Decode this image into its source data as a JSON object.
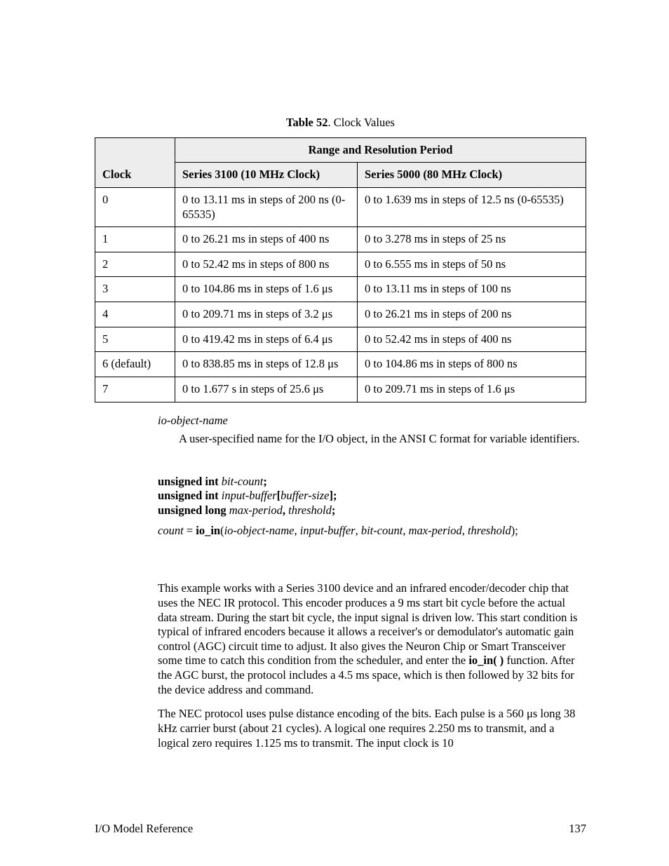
{
  "caption": {
    "label": "Table 52",
    "title": ". Clock Values"
  },
  "table": {
    "clock_header": "Clock",
    "super_header": "Range and Resolution Period",
    "col_3100": "Series 3100 (10 MHz Clock)",
    "col_5000": "Series 5000 (80 MHz Clock)",
    "rows": [
      {
        "clock": "0",
        "s3100": "0 to 13.11 ms in steps of 200 ns (0-65535)",
        "s5000": "0 to 1.639 ms in steps of 12.5 ns (0-65535)"
      },
      {
        "clock": "1",
        "s3100": "0 to 26.21 ms in steps of 400 ns",
        "s5000": "0 to 3.278 ms in steps of 25 ns"
      },
      {
        "clock": "2",
        "s3100": "0 to 52.42 ms in steps of 800 ns",
        "s5000": "0 to 6.555 ms in steps of 50 ns"
      },
      {
        "clock": "3",
        "s3100": "0 to 104.86 ms in steps of 1.6 μs",
        "s5000": "0 to 13.11 ms in steps of 100 ns"
      },
      {
        "clock": "4",
        "s3100": "0 to 209.71 ms in steps of 3.2 μs",
        "s5000": "0 to 26.21 ms in steps of 200 ns"
      },
      {
        "clock": "5",
        "s3100": "0 to 419.42 ms in steps of 6.4 μs",
        "s5000": "0 to 52.42 ms in steps of 400 ns"
      },
      {
        "clock": "6 (default)",
        "s3100": "0 to 838.85 ms in steps of 12.8 μs",
        "s5000": "0 to 104.86 ms in steps of 800 ns"
      },
      {
        "clock": "7",
        "s3100": "0 to 1.677 s in steps of 25.6 μs",
        "s5000": "0 to 209.71 ms in steps of 1.6 μs"
      }
    ]
  },
  "param": {
    "name": "io-object-name",
    "desc": "A user-specified name for the I/O object, in the ANSI C format for variable identifiers."
  },
  "syntax": {
    "l1a": "unsigned int",
    "l1b": " bit-count",
    "l1c": ";",
    "l2a": "unsigned int",
    "l2b": " input-buffer",
    "l2c": "[",
    "l2d": "buffer-size",
    "l2e": "];",
    "l3a": "unsigned long",
    "l3b": " max-period",
    "l3c": ",",
    "l3d": " threshold",
    "l3e": ";",
    "call_a": "count",
    "call_b": " = ",
    "call_c": "io_in",
    "call_d": "(",
    "call_e": "io-object-name",
    "call_f": ", ",
    "call_g": "input-buffer",
    "call_h": ", ",
    "call_i": "bit-count",
    "call_j": ", ",
    "call_k": "max-period",
    "call_l": ", ",
    "call_m": "threshold",
    "call_n": ");"
  },
  "example": {
    "p1a": "This example works with a Series 3100 device and an infrared encoder/decoder chip that uses the NEC IR protocol.  This encoder produces a 9 ms start bit cycle before the actual data stream.  During the start bit cycle, the input signal is driven low.  This start condition is typical of infrared encoders because it allows a receiver's or demodulator's automatic gain control (AGC) circuit time to adjust.  It also gives the Neuron Chip or Smart Transceiver some time to catch this condition from the scheduler, and enter the ",
    "p1b": "io_in( )",
    "p1c": " function.  After the AGC burst, the protocol includes a 4.5 ms space, which is then followed by 32 bits for the device address and command.",
    "p2": "The NEC protocol uses pulse distance encoding of the bits.  Each pulse is a 560 μs long 38 kHz carrier burst (about 21 cycles).  A logical one requires 2.250 ms to transmit, and a logical zero requires 1.125 ms to transmit.  The input clock is 10"
  },
  "footer": {
    "left": "I/O Model Reference",
    "right": "137"
  }
}
